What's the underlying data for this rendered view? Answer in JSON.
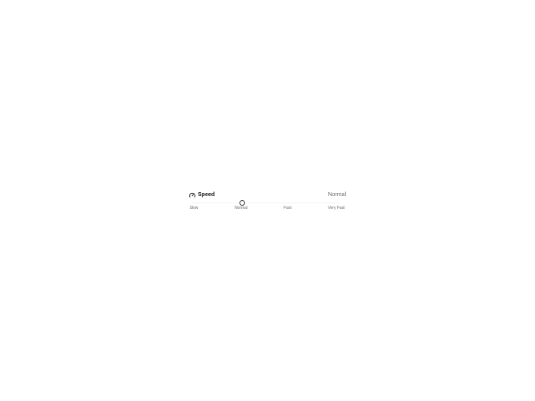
{
  "speed": {
    "icon": "gauge-icon",
    "label": "Speed",
    "current_value": "Normal",
    "selected_index": 1,
    "options": [
      "Slow",
      "Normal",
      "Fast",
      "Very Fast"
    ],
    "colors": {
      "text": "#111111",
      "muted_text": "#6b6b6b",
      "thumb_border": "#444444",
      "track": "#f3f3f3"
    }
  }
}
